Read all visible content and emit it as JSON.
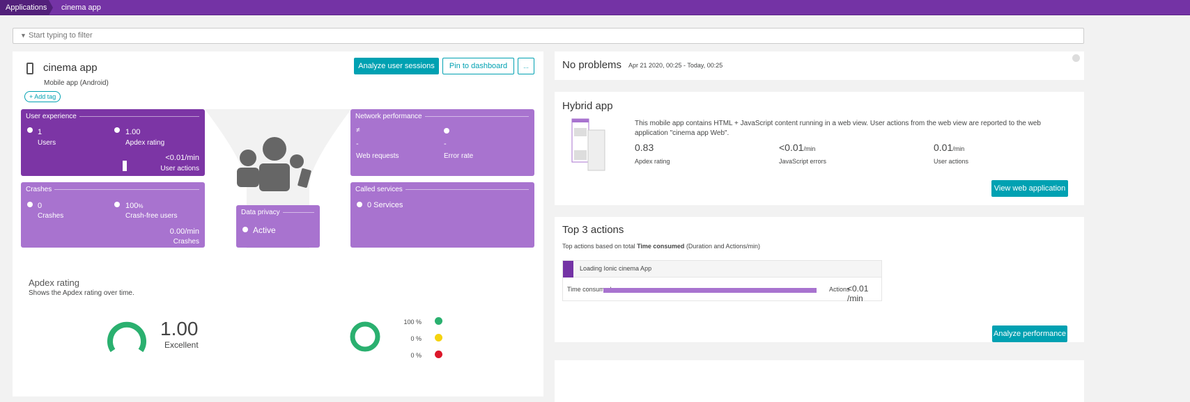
{
  "breadcrumb": {
    "root": "Applications",
    "current": "cinema app"
  },
  "filter": {
    "placeholder": "Start typing to filter"
  },
  "app": {
    "name": "cinema app",
    "type": "Mobile app (Android)",
    "add_tag": "Add tag",
    "analyze_sessions": "Analyze user sessions",
    "pin": "Pin to dashboard",
    "more": "..."
  },
  "tiles": {
    "user_experience": {
      "title": "User experience",
      "users": "1",
      "users_label": "Users",
      "apdex": "1.00",
      "apdex_label": "Apdex rating",
      "actions": "<0.01/min",
      "actions_label": "User actions"
    },
    "crashes": {
      "title": "Crashes",
      "crashes": "0",
      "crashes_label": "Crashes",
      "crash_free": "100",
      "crash_free_unit": "%",
      "crash_free_label": "Crash-free users",
      "rate": "0.00/min",
      "rate_label": "Crashes"
    },
    "network": {
      "title": "Network performance",
      "web_requests": "-",
      "web_requests_label": "Web requests",
      "error_rate": "-",
      "error_rate_label": "Error rate"
    },
    "called_services": {
      "title": "Called services",
      "value": "0 Services"
    },
    "privacy": {
      "title": "Data privacy",
      "value": "Active"
    }
  },
  "apdex": {
    "title": "Apdex rating",
    "subtitle": "Shows the Apdex rating over time.",
    "value": "1.00",
    "label": "Excellent",
    "satisfied": "100 %",
    "tolerating": "0 %",
    "frustrated": "0 %",
    "satisfied_fraction": 1.0
  },
  "problems": {
    "title": "No problems",
    "range": "Apr 21 2020, 00:25 - Today, 00:25"
  },
  "hybrid": {
    "title": "Hybrid app",
    "description": "This mobile app contains HTML + JavaScript content running in a web view. User actions from the web view are reported to the web application \"cinema app Web\".",
    "apdex": "0.83",
    "apdex_label": "Apdex rating",
    "js_errors": "<0.01",
    "js_errors_unit": "/min",
    "js_errors_label": "JavaScript errors",
    "user_actions": "0.01",
    "user_actions_unit": "/min",
    "user_actions_label": "User actions",
    "button": "View web application"
  },
  "top_actions": {
    "title": "Top 3 actions",
    "subtitle_pre": "Top actions based on total ",
    "subtitle_bold": "Time consumed",
    "subtitle_post": " (Duration and Actions/min)",
    "action_name": "Loading Ionic cinema App",
    "time_label": "Time consumed",
    "time_fraction": 1.0,
    "actions_label": "Actions",
    "actions_value": "<0.01 /min",
    "button": "Analyze performance"
  },
  "colors": {
    "purple": "#7433a5",
    "tile": "#a873cf",
    "teal": "#00a1b2",
    "green": "#2ab06f"
  }
}
